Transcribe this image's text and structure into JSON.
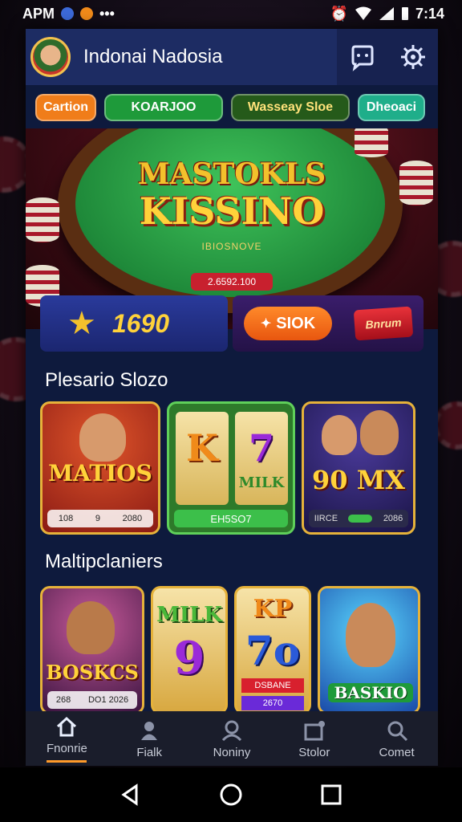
{
  "status_bar": {
    "left_text": "APM",
    "time": "7:14"
  },
  "header": {
    "title": "Indonai Nadosia",
    "icons": [
      "chat-icon",
      "settings-icon"
    ]
  },
  "chips": [
    {
      "label": "Cartion",
      "color": "#f07d1a"
    },
    {
      "label": "KOARJOO",
      "color": "#1e9a3a"
    },
    {
      "label": "Wasseay Sloe",
      "color": "#255a1a"
    },
    {
      "label": "Dheoaci",
      "color": "#1fae8a"
    }
  ],
  "hero": {
    "logo_line1": "MASTOKLS",
    "logo_line2": "KISSINO",
    "subtitle": "IBIOSNOVE",
    "value": "2.6592.100"
  },
  "balance": {
    "value": "1690",
    "icon": "star-icon"
  },
  "actions": {
    "primary_label": "SIOK",
    "secondary_label": "Bnrum"
  },
  "sections": [
    {
      "title": "Plesario Slozo",
      "tiles": [
        {
          "label": "MATIOS",
          "footer": [
            "108",
            "9",
            "2080"
          ]
        },
        {
          "label_left": "K",
          "label_right": "7",
          "sub": "MILK",
          "footer_text": "EH5SO7"
        },
        {
          "label": "90 MX",
          "footer": [
            "IIRCE",
            "2086"
          ]
        }
      ]
    },
    {
      "title": "Maltipclaniers",
      "tiles": [
        {
          "label": "BOSKCS",
          "footer": [
            "268",
            "DO1 2026"
          ]
        },
        {
          "label_top": "MILK",
          "label_main": "9"
        },
        {
          "label_top": "KP",
          "label_main": "7o",
          "footer_text": "DSBANE",
          "footer2": "2670"
        },
        {
          "label": "BASKIO"
        }
      ]
    }
  ],
  "bottom_nav": [
    {
      "label": "Fnonrie",
      "icon": "home-icon",
      "active": true
    },
    {
      "label": "Fialk",
      "icon": "person-icon",
      "active": false
    },
    {
      "label": "Noniny",
      "icon": "account-icon",
      "active": false
    },
    {
      "label": "Stolor",
      "icon": "store-icon",
      "active": false
    },
    {
      "label": "Comet",
      "icon": "search-icon",
      "active": false
    }
  ]
}
